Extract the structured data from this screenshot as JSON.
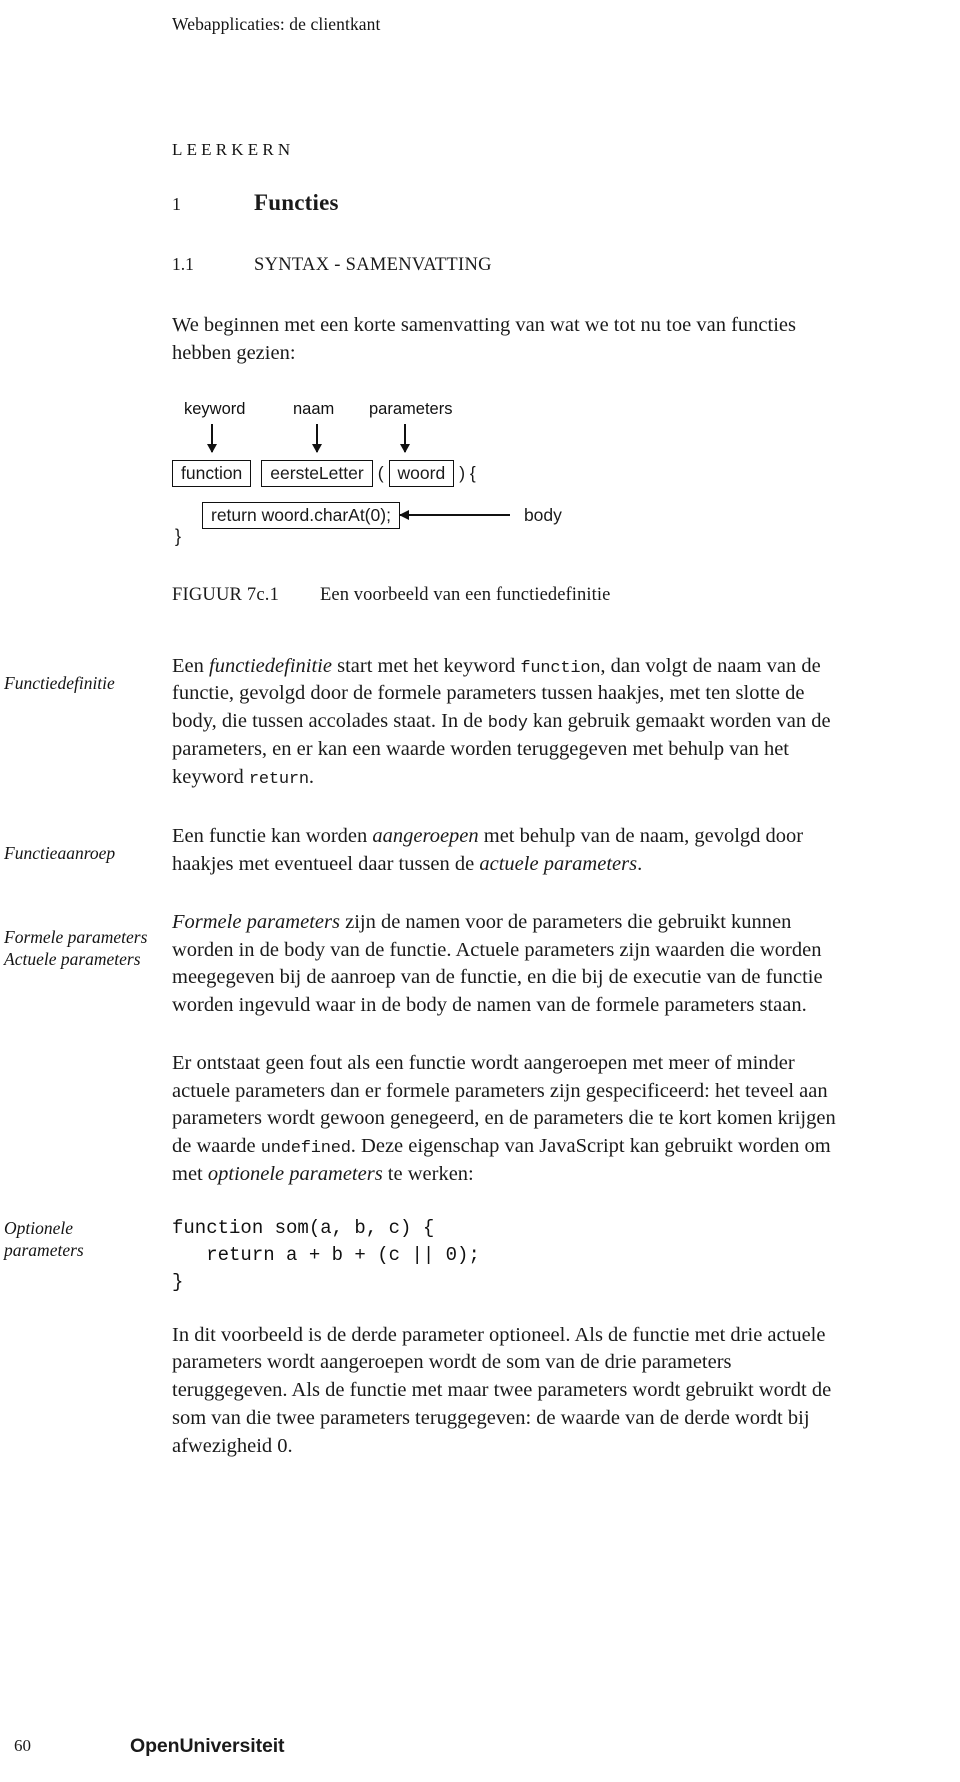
{
  "running_head": "Webapplicaties: de clientkant",
  "section": {
    "kicker": "LEERKERN",
    "chapter_number": "1",
    "chapter_title": "Functies",
    "subsection_number": "1.1",
    "subsection_title": "SYNTAX - SAMENVATTING"
  },
  "intro_paragraph": "We beginnen met een korte samenvatting van wat we tot nu toe van functies hebben gezien:",
  "figure": {
    "labels": {
      "keyword": "keyword",
      "naam": "naam",
      "parameters": "parameters",
      "body": "body"
    },
    "code": {
      "box_keyword": "function",
      "box_name": "eersteLetter",
      "paren_open": "(",
      "box_param": "woord",
      "paren_close_brace": ") {",
      "box_body": "return woord.charAt(0);",
      "brace_close": "}"
    },
    "caption_number": "FIGUUR 7c.1",
    "caption_text": "Een voorbeeld van een functiedefinitie"
  },
  "margin_notes": {
    "functiedefinitie": "Functiedefinitie",
    "functieaanroep": "Functieaanroep",
    "formele_parameters": "Formele parameters",
    "actuele_parameters": "Actuele parameters",
    "optionele_line1": "Optionele",
    "optionele_line2": "parameters"
  },
  "paragraphs": {
    "p1_a": "Een ",
    "p1_b": "functiedefinitie",
    "p1_c": " start met het keyword ",
    "p1_d": "function",
    "p1_e": ", dan volgt de naam van de functie, gevolgd door de formele parameters tussen haakjes, met ten slotte de body, die tussen accolades staat. In de ",
    "p1_f": "body",
    "p1_g": " kan gebruik gemaakt worden van de parameters, en er kan een waarde worden teruggegeven met behulp van het keyword ",
    "p1_h": "return",
    "p1_i": ".",
    "p2_a": "Een functie kan worden ",
    "p2_b": "aangeroepen",
    "p2_c": " met behulp van de naam, gevolgd door haakjes met eventueel daar tussen de ",
    "p2_d": "actuele parameters",
    "p2_e": ".",
    "p3_a": "Formele parameters",
    "p3_b": " zijn de namen voor de parameters die gebruikt kunnen worden in de body van de functie. Actuele parameters zijn waarden die worden meegegeven bij de aanroep van de functie, en die bij de executie van de functie worden ingevuld waar in de body de namen van de formele parameters staan.",
    "p4_a": "Er ontstaat geen fout als een functie wordt aangeroepen met meer of minder actuele parameters dan er formele parameters zijn gespecificeerd: het teveel aan parameters wordt gewoon genegeerd, en de parameters die te kort komen krijgen de waarde ",
    "p4_b": "undefined",
    "p4_c": ". Deze eigenschap van JavaScript kan gebruikt worden om met ",
    "p4_d": "optionele parameters",
    "p4_e": " te werken:",
    "p5": "In dit voorbeeld is de derde parameter optioneel. Als de functie met drie actuele parameters wordt aangeroepen wordt de som van de drie parameters teruggegeven. Als de functie met maar twee parameters wordt gebruikt wordt de som van die twee parameters teruggegeven: de waarde van de derde wordt bij afwezigheid 0."
  },
  "code_example": "function som(a, b, c) {\n   return a + b + (c || 0);\n}",
  "footer": {
    "page_number": "60",
    "brand_open": "Open",
    "brand_rest": "Universiteit"
  }
}
